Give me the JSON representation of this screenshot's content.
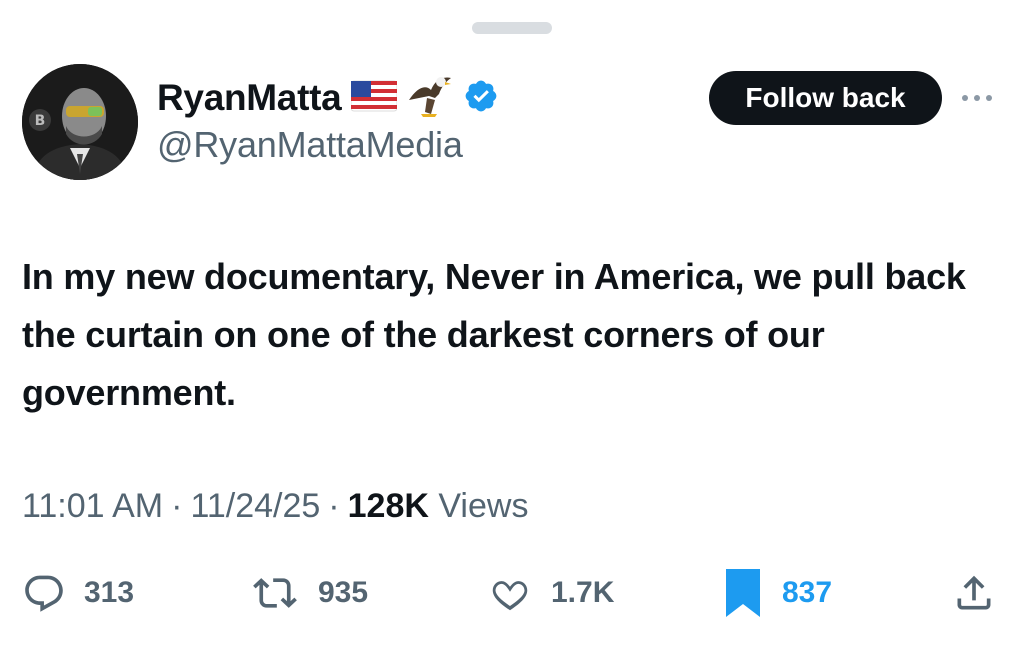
{
  "author": {
    "display_name": "RyanMatta",
    "name_emojis": [
      "flag-us-icon",
      "eagle-icon"
    ],
    "verified": true,
    "handle": "@RyanMattaMedia",
    "follow_button_label": "Follow back"
  },
  "tweet": {
    "text": "In my new documentary, Never in America, we pull back the curtain on one of the darkest corners of our government."
  },
  "meta": {
    "time": "11:01 AM",
    "date": "11/24/25",
    "views_count": "128K",
    "views_label": "Views",
    "separator": "·"
  },
  "actions": {
    "replies": "313",
    "reposts": "935",
    "likes": "1.7K",
    "bookmarks": "837",
    "bookmarked": true
  },
  "colors": {
    "text": "#0f1419",
    "secondary": "#536471",
    "accent": "#1d9bf0"
  }
}
